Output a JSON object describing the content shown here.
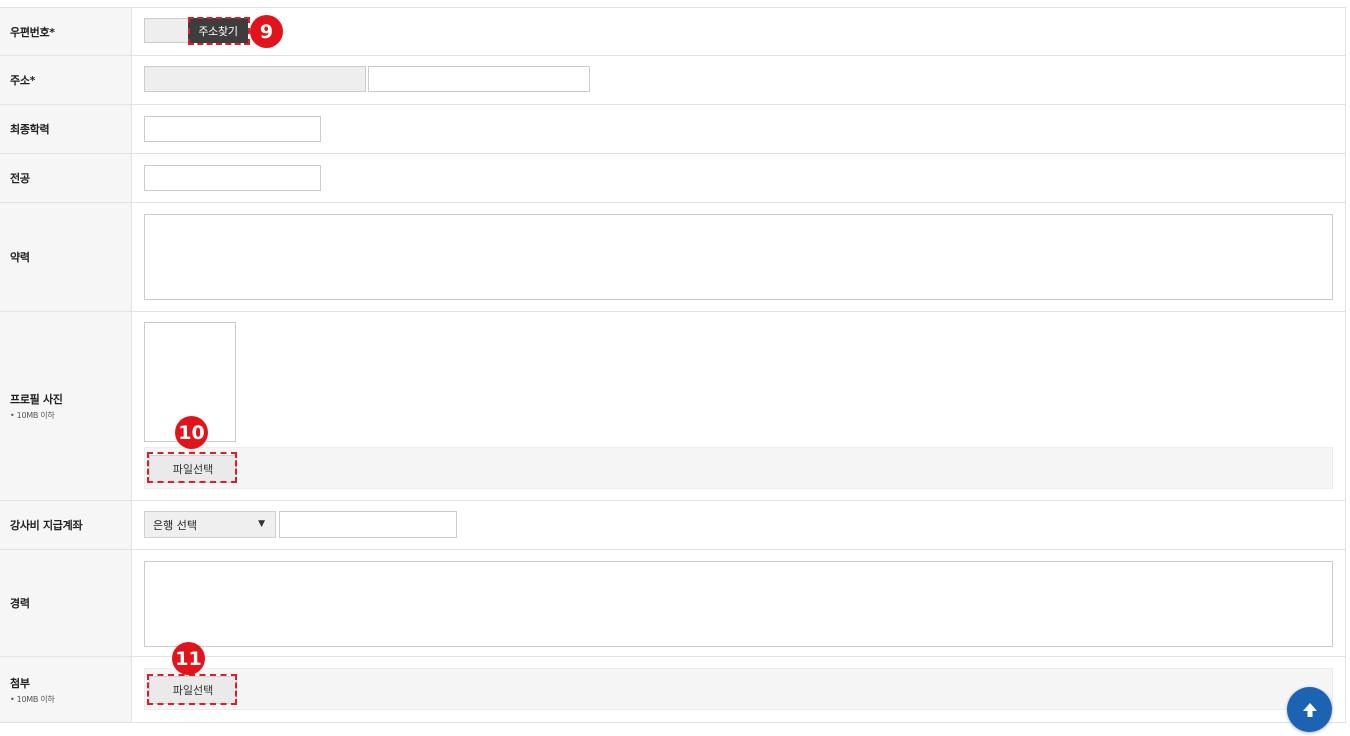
{
  "fields": {
    "postcode": {
      "label": "우편번호*",
      "search_button": "주소찾기",
      "marker": "9"
    },
    "address": {
      "label": "주소*"
    },
    "education": {
      "label": "최종학력"
    },
    "major": {
      "label": "전공"
    },
    "brief_history": {
      "label": "약력"
    },
    "profile_photo": {
      "label": "프로필 사진",
      "note": "• 10MB 이하",
      "file_button": "파일선택",
      "marker": "10"
    },
    "bank_account": {
      "label": "강사비 지급계좌",
      "bank_select": "은행 선택",
      "arrow": "▼"
    },
    "career": {
      "label": "경력"
    },
    "attachment": {
      "label": "첨부",
      "note": "• 10MB 이하",
      "file_button": "파일선택",
      "marker": "11"
    }
  },
  "colors": {
    "marker_red": "#e1141c",
    "dark_button": "#3d3d3d",
    "scroll_top_blue": "#1c64b3"
  },
  "icons": {
    "scroll_top": "arrow-up-icon"
  }
}
